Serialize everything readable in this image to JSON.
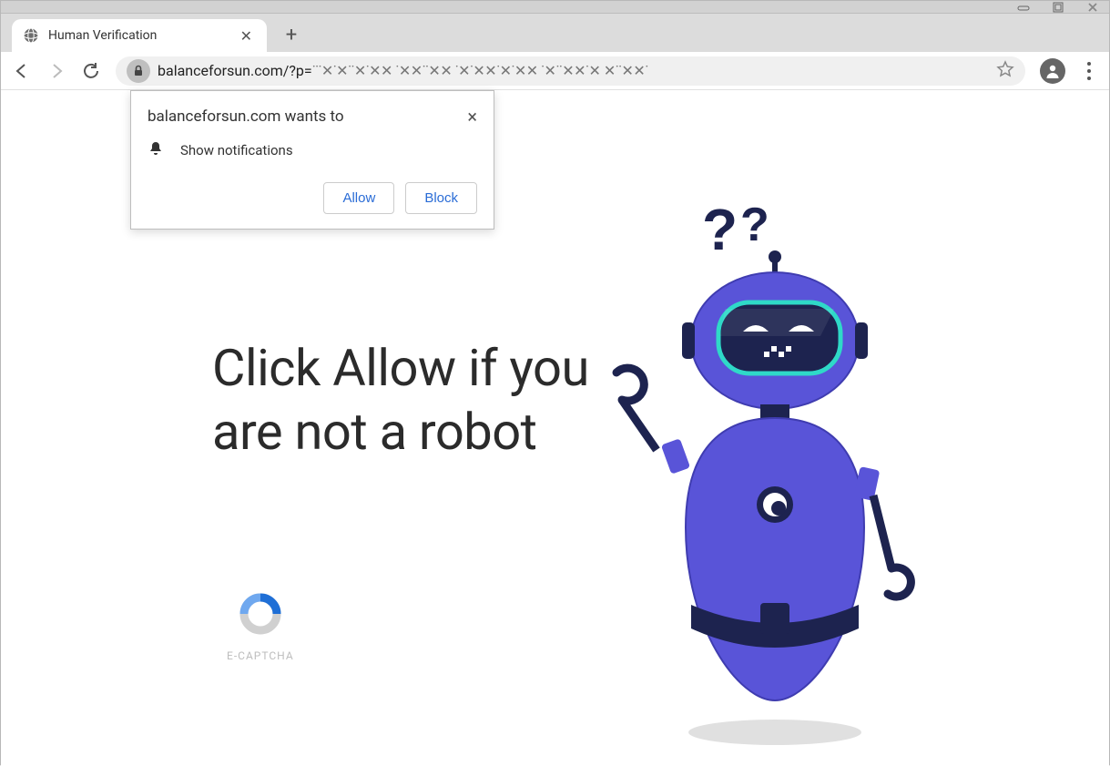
{
  "window_controls": {
    "minimize": "minimize",
    "maximize": "maximize",
    "close": "close"
  },
  "tab": {
    "title": "Human Verification",
    "favicon": "globe-icon"
  },
  "newtab_label": "+",
  "addressbar": {
    "url_visible": "balanceforsun.com/?p=",
    "url_obscured": "˙˙˙✕˙✕˙˙✕˙✕✕ ˙✕✕˙˙✕✕ ˙✕˙✕✕˙✕˙✕✕ ˙✕˙˙✕✕˙✕ ✕˙˙✕✕˙",
    "lock": "secure"
  },
  "permission_dialog": {
    "title": "balanceforsun.com wants to",
    "request_label": "Show notifications",
    "bell_icon": "bell-icon",
    "allow_label": "Allow",
    "block_label": "Block",
    "close_label": "×"
  },
  "page": {
    "headline": "Click Allow if you are not a robot",
    "captcha_label": "E-CAPTCHA",
    "robot_alt": "confused-robot-illustration",
    "question_marks": "??"
  }
}
